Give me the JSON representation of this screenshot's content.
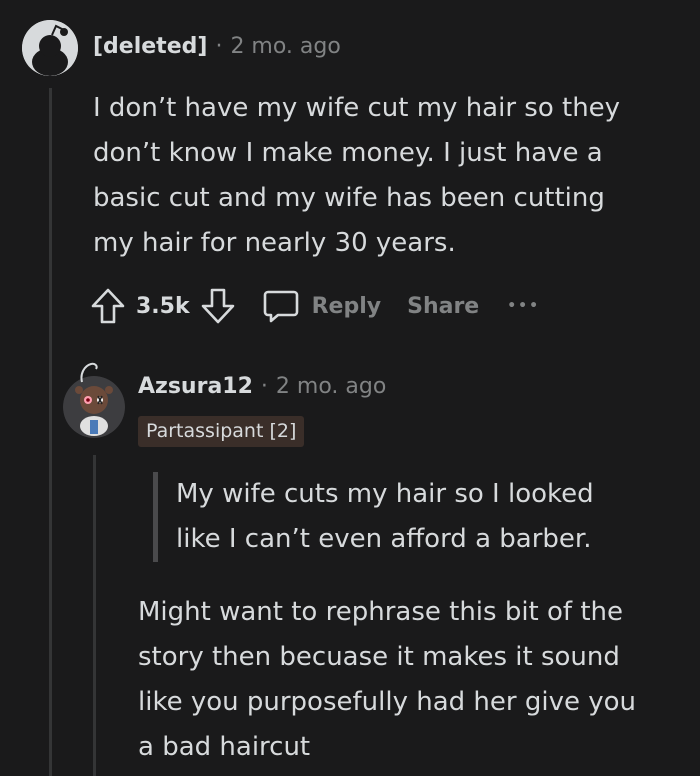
{
  "comment1": {
    "author": "[deleted]",
    "separator": "·",
    "timestamp": "2 mo. ago",
    "body_lines": [
      "I don’t have my wife cut my hair so they",
      "don’t know I make money. I just have a",
      "basic cut and my wife has been cutting",
      "my hair for nearly 30 years."
    ],
    "votes": "3.5k",
    "reply_label": "Reply",
    "share_label": "Share",
    "more_label": "•••"
  },
  "comment2": {
    "author": "Azsura12",
    "separator": "·",
    "timestamp": "2 mo. ago",
    "flair": "Partassipant [2]",
    "quote_lines": [
      "My wife cuts my hair so I looked",
      "like I can’t even afford a barber."
    ],
    "body_lines": [
      "Might want to rephrase this bit of the",
      "story then becuase it makes it sound",
      "like you purposefully had her give you",
      "a bad haircut"
    ]
  },
  "icons": {
    "upvote": "upvote-arrow-icon",
    "downvote": "downvote-arrow-icon",
    "reply": "speech-bubble-icon",
    "more": "more-dots-icon"
  },
  "colors": {
    "background": "#1a1a1b",
    "text": "#d7dadc",
    "muted": "#818384",
    "flair_bg": "#3a2e29"
  }
}
